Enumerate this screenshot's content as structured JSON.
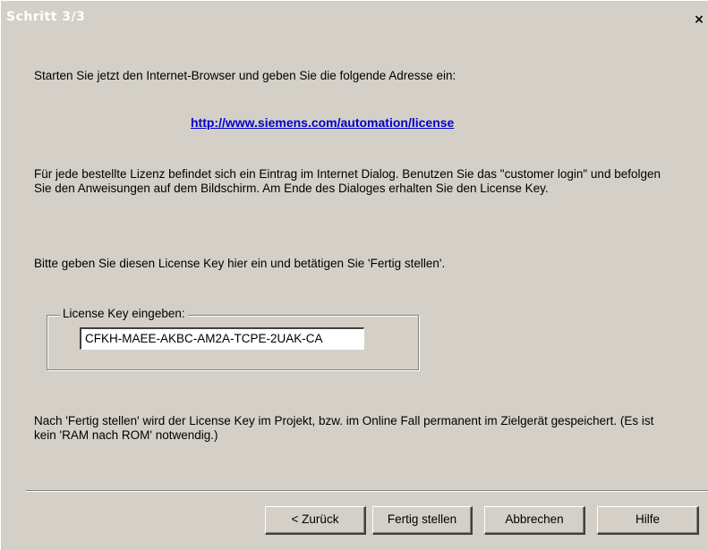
{
  "window": {
    "title": "Schritt 3/3",
    "close_glyph": "×"
  },
  "content": {
    "intro": "Starten Sie jetzt den Internet-Browser und geben Sie die folgende Adresse ein:",
    "url": "http://www.siemens.com/automation/license",
    "paragraph1": "Für jede bestellte Lizenz befindet sich ein Eintrag im Internet Dialog. Benutzen Sie das \"customer login\" und befolgen Sie den Anweisungen auf dem Bildschirm. Am Ende des Dialoges erhalten Sie den License Key.",
    "paragraph2": "Bitte geben Sie diesen License Key hier ein und betätigen Sie 'Fertig stellen'.",
    "license_group_label": "License Key eingeben:",
    "license_key_value": "CFKH-MAEE-AKBC-AM2A-TCPE-2UAK-CA",
    "paragraph3": "Nach 'Fertig stellen' wird der License Key im Projekt, bzw. im Online Fall permanent im Zielgerät gespeichert. (Es ist kein 'RAM nach ROM' notwendig.)"
  },
  "buttons": {
    "back": "< Zurück",
    "finish": "Fertig stellen",
    "cancel": "Abbrechen",
    "help": "Hilfe"
  }
}
